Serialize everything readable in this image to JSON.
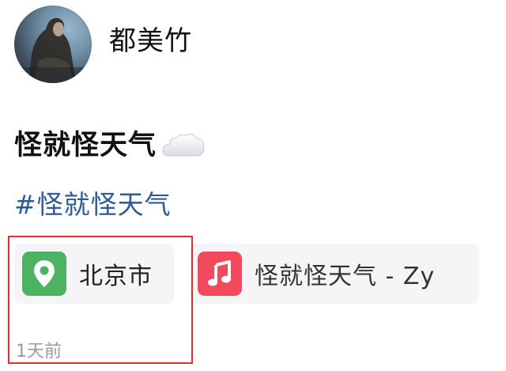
{
  "user": {
    "name": "都美竹"
  },
  "post": {
    "text": "怪就怪天气",
    "hashtag": "#怪就怪天气"
  },
  "chips": {
    "location": {
      "label": "北京市",
      "icon": "location-pin-icon",
      "color": "#4bb462"
    },
    "music": {
      "label": "怪就怪天气 - Zy",
      "icon": "music-note-icon",
      "color": "#f2495c"
    }
  },
  "meta": {
    "time": "1天前"
  },
  "colors": {
    "hashtag": "#2b5a9c",
    "highlight": "#e3302f"
  }
}
